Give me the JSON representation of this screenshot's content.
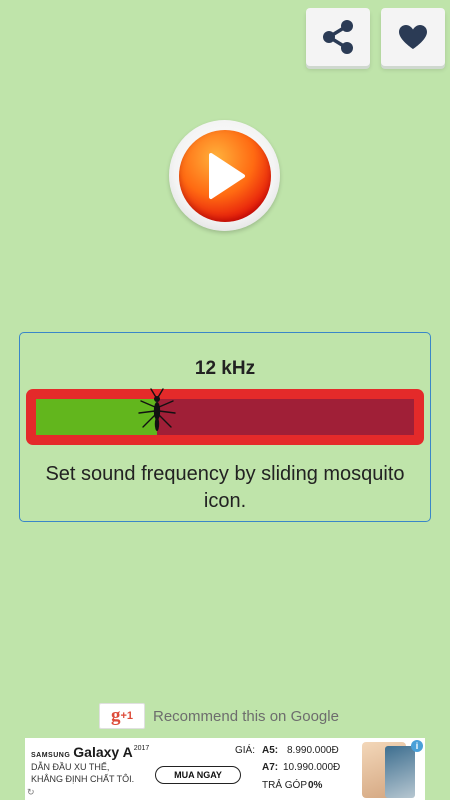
{
  "top_bar": {
    "share_icon": "share-icon",
    "favorite_icon": "heart-icon"
  },
  "player": {
    "play_icon": "play-icon"
  },
  "frequency": {
    "value_label": "12 kHz",
    "slider_fraction": 0.32,
    "instructions": "Set sound frequency by sliding mosquito icon.",
    "handle_icon": "mosquito-icon"
  },
  "recommend": {
    "gplus_label": "g",
    "gplus_suffix": "+1",
    "text": "Recommend this on Google"
  },
  "ad": {
    "brand_prefix": "SAMSUNG",
    "brand_name": "Galaxy A",
    "brand_year": "2017",
    "tagline_1": "DẪN ĐẦU XU THẾ,",
    "tagline_2": "KHẲNG ĐỊNH CHẤT TÔI.",
    "cta": "MUA NGAY",
    "price_prefix": "GIÁ:",
    "a5_label": "A5:",
    "a5_price": "8.990.000Đ",
    "a7_label": "A7:",
    "a7_price": "10.990.000Đ",
    "installment": "TRẢ GÓP",
    "installment_rate": "0%",
    "info_label": "i",
    "corner_mark": "↻"
  },
  "colors": {
    "background": "#bfe4aa",
    "panel_border": "#3a86c8",
    "slider_border": "#e42a2a",
    "slider_fill": "#62b61d",
    "slider_track": "#a01f37",
    "icon": "#2b3b55"
  }
}
